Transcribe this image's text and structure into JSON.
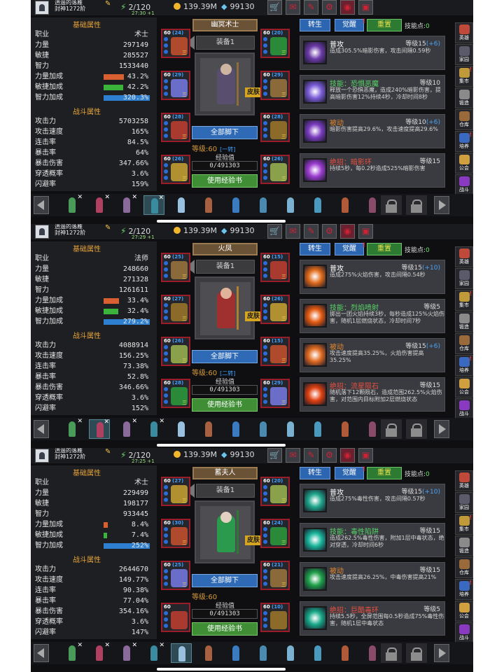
{
  "colors": {
    "strength_bar": "#d86030",
    "agility_bar": "#3ab43a",
    "intellect_bar": "#2f7fd0",
    "slot_border": "#9a1d2a"
  },
  "panels": [
    {
      "topbar": {
        "name_line1": "逍遥的落雁",
        "name_line2": "封神1272阶",
        "vitality": "2/120",
        "timer": "27:30 +1",
        "gold": "139.39M",
        "gems": "99130"
      },
      "basic_title": "基础属性",
      "basic": [
        {
          "label": "职业",
          "value": "术士"
        },
        {
          "label": "力量",
          "value": "297149"
        },
        {
          "label": "敏捷",
          "value": "285527"
        },
        {
          "label": "智力",
          "value": "1533440"
        },
        {
          "label": "力量加成",
          "value": "43.2%",
          "pct": 0.432
        },
        {
          "label": "敏捷加成",
          "value": "42.2%",
          "pct": 0.422
        },
        {
          "label": "智力加成",
          "value": "320.3%",
          "pct": 1
        }
      ],
      "battle_title": "战斗属性",
      "battle": [
        {
          "label": "攻击力",
          "value": "5703258"
        },
        {
          "label": "攻击速度",
          "value": "165%"
        },
        {
          "label": "连击率",
          "value": "84.5%"
        },
        {
          "label": "暴击率",
          "value": "64%"
        },
        {
          "label": "暴击伤害",
          "value": "347.66%"
        },
        {
          "label": "穿透概率",
          "value": "3.6%"
        },
        {
          "label": "闪避率",
          "value": "159%"
        }
      ],
      "hero_name": "幽冥术士",
      "equip_label": "装备1",
      "skin": "皮肤",
      "slots": [
        {
          "lv": "60",
          "plus": "(24)",
          "stage": "三"
        },
        {
          "lv": "60",
          "plus": "(20)",
          "stage": "三"
        },
        {
          "lv": "60",
          "plus": "(29)",
          "stage": "三"
        },
        {
          "lv": "60",
          "plus": "(29)",
          "stage": "三"
        },
        {
          "lv": "60",
          "plus": "(28)",
          "stage": "三"
        },
        {
          "lv": "60",
          "plus": "(28)",
          "stage": "三"
        },
        {
          "lv": "60",
          "plus": "(26)",
          "stage": "三"
        },
        {
          "lv": "60",
          "plus": "(26)",
          "stage": "三"
        }
      ],
      "unequip": "全部脚下",
      "level": "等级:60",
      "stage_tag": "[一转]",
      "exp_label": "经验值",
      "exp": "0/491303",
      "use_exp": "使用经验书",
      "tabs": {
        "t1": "转生",
        "t2": "觉醒",
        "t3": "重置",
        "sp_label": "技能点:",
        "sp": "0"
      },
      "skills": [
        {
          "name": "普攻",
          "lv": "等级15",
          "plus": "(+6)",
          "desc": "造成305.5%暗影伤害，攻击间隔0.59秒"
        },
        {
          "name": "技能：恐惧恶魔",
          "lv": "等级10",
          "plus": "",
          "desc": "释放一个恐惧恶魔，造成240%暗影伤害，提高暗影伤害12%持续4秒，冷却时间8秒"
        },
        {
          "name": "被动",
          "lv": "等级10",
          "plus": "(+6)",
          "desc": "暗影伤害提高29.6%，攻击速度提高29.6%"
        },
        {
          "name": "绝招：暗影环",
          "lv": "等级15",
          "plus": "",
          "desc": "持续5秒，每0.2秒造成525%暗影伤害"
        }
      ]
    },
    {
      "topbar": {
        "name_line1": "逍遥的落雁",
        "name_line2": "封神1272阶",
        "vitality": "2/120",
        "timer": "27:29 +1",
        "gold": "139.39M",
        "gems": "99130"
      },
      "basic_title": "基础属性",
      "basic": [
        {
          "label": "职业",
          "value": "法师"
        },
        {
          "label": "力量",
          "value": "248660"
        },
        {
          "label": "敏捷",
          "value": "271328"
        },
        {
          "label": "智力",
          "value": "1261611"
        },
        {
          "label": "力量加成",
          "value": "33.4%",
          "pct": 0.334
        },
        {
          "label": "敏捷加成",
          "value": "32.4%",
          "pct": 0.324
        },
        {
          "label": "智力加成",
          "value": "279.2%",
          "pct": 1
        }
      ],
      "battle_title": "战斗属性",
      "battle": [
        {
          "label": "攻击力",
          "value": "4088914"
        },
        {
          "label": "攻击速度",
          "value": "156.25%"
        },
        {
          "label": "连击率",
          "value": "73.38%"
        },
        {
          "label": "暴击率",
          "value": "52.8%"
        },
        {
          "label": "暴击伤害",
          "value": "346.66%"
        },
        {
          "label": "穿透概率",
          "value": "3.6%"
        },
        {
          "label": "闪避率",
          "value": "152%"
        }
      ],
      "hero_name": "火凤",
      "equip_label": "装备1",
      "skin": "皮肤",
      "slots": [
        {
          "lv": "60",
          "plus": "(25)",
          "stage": "三"
        },
        {
          "lv": "60",
          "plus": "(15)",
          "stage": "三"
        },
        {
          "lv": "60",
          "plus": "(27)",
          "stage": "三"
        },
        {
          "lv": "60",
          "plus": "(26)",
          "stage": "三"
        },
        {
          "lv": "60",
          "plus": "(26)",
          "stage": "三"
        },
        {
          "lv": "60",
          "plus": "(15)",
          "stage": "三"
        },
        {
          "lv": "60",
          "plus": "(28)",
          "stage": "三"
        },
        {
          "lv": "60",
          "plus": "(29)",
          "stage": "三"
        }
      ],
      "unequip": "全部脚下",
      "level": "等级:60",
      "stage_tag": "[二转]",
      "exp_label": "经验值",
      "exp": "0/491303",
      "use_exp": "使用经验书",
      "tabs": {
        "t1": "转生",
        "t2": "觉醒",
        "t3": "重置",
        "sp_label": "技能点:",
        "sp": "0"
      },
      "skills": [
        {
          "name": "普攻",
          "lv": "等级15",
          "plus": "(+10)",
          "desc": "造成275%火焰伤害，攻击间隔0.54秒"
        },
        {
          "name": "技能：烈焰喷射",
          "lv": "等级5",
          "plus": "",
          "desc": "掷出一团火焰持续3秒，每秒造成125%火焰伤害，随机1层燃烧状态，冷却时间7秒"
        },
        {
          "name": "被动",
          "lv": "等级15",
          "plus": "(+6)",
          "desc": "攻击速度提高35.25%，火焰伤害提高35.25%"
        },
        {
          "name": "绝招：流星陨石",
          "lv": "等级15",
          "plus": "",
          "desc": "随机落下12颗陨石，造成范围262.5%火焰伤害，对范围内目标附加2层燃烧状态"
        }
      ]
    },
    {
      "topbar": {
        "name_line1": "逍遥的落雁",
        "name_line2": "封神1272阶",
        "vitality": "2/120",
        "timer": "27:25 +1",
        "gold": "139.39M",
        "gems": "99130"
      },
      "basic_title": "基础属性",
      "basic": [
        {
          "label": "职业",
          "value": "术士"
        },
        {
          "label": "力量",
          "value": "229499"
        },
        {
          "label": "敏捷",
          "value": "198177"
        },
        {
          "label": "智力",
          "value": "933445"
        },
        {
          "label": "力量加成",
          "value": "8.4%",
          "pct": 0.084
        },
        {
          "label": "敏捷加成",
          "value": "7.4%",
          "pct": 0.074
        },
        {
          "label": "智力加成",
          "value": "252%",
          "pct": 1
        }
      ],
      "battle_title": "战斗属性",
      "battle": [
        {
          "label": "攻击力",
          "value": "2644670"
        },
        {
          "label": "攻击速度",
          "value": "149.77%"
        },
        {
          "label": "连击率",
          "value": "90.38%"
        },
        {
          "label": "暴击率",
          "value": "77.04%"
        },
        {
          "label": "暴击伤害",
          "value": "354.16%"
        },
        {
          "label": "穿透概率",
          "value": "3.6%"
        },
        {
          "label": "闪避率",
          "value": "147%"
        }
      ],
      "hero_name": "蓄夫人",
      "equip_label": "装备1",
      "skin": "皮肤",
      "slots": [
        {
          "lv": "60",
          "plus": "(27)",
          "stage": "三"
        },
        {
          "lv": "60",
          "plus": "(20)",
          "stage": "三"
        },
        {
          "lv": "60",
          "plus": "(30)",
          "stage": "三"
        },
        {
          "lv": "60",
          "plus": "(24)",
          "stage": "三"
        },
        {
          "lv": "60",
          "plus": "(25)",
          "stage": "三"
        },
        {
          "lv": "60",
          "plus": "(21)",
          "stage": "三"
        },
        {
          "lv": "60",
          "plus": "",
          "stage": ""
        },
        {
          "lv": "60",
          "plus": "(10)",
          "stage": ""
        }
      ],
      "unequip": "全部脚下",
      "level": "等级:60",
      "stage_tag": "",
      "exp_label": "经验值",
      "exp": "0/491303",
      "use_exp": "使用经验书",
      "tabs": {
        "t1": "转生",
        "t2": "觉醒",
        "t3": "重置",
        "sp_label": "技能点:",
        "sp": "0"
      },
      "skills": [
        {
          "name": "普攻",
          "lv": "等级15",
          "plus": "(+10)",
          "desc": "造成275%毒性伤害，攻击间隔0.57秒"
        },
        {
          "name": "技能：毒性陷阱",
          "lv": "等级15",
          "plus": "",
          "desc": "造成262.5%毒性伤害，附加1层中毒状态，绝对穿透，冷却时间6秒"
        },
        {
          "name": "被动",
          "lv": "等级15",
          "plus": "",
          "desc": "攻击速度提高26.25%，中毒伤害提高21%"
        },
        {
          "name": "绝招：巨酷毒环",
          "lv": "等级5",
          "plus": "",
          "desc": "持续5.5秒，全屏范围每0.5秒造成75%毒性伤害，随机1层中毒状态"
        }
      ]
    }
  ],
  "side_buttons": [
    "英雄",
    "家园",
    "集市",
    "锻造",
    "仓库",
    "培养",
    "公会",
    "战斗"
  ]
}
